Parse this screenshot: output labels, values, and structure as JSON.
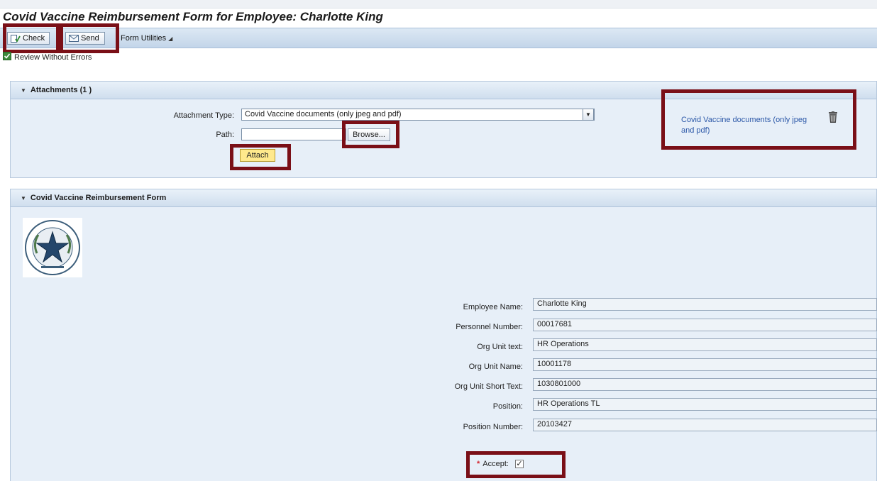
{
  "title": "Covid Vaccine Reimbursement Form for Employee: Charlotte King",
  "toolbar": {
    "check_label": "Check",
    "send_label": "Send",
    "utilities_label": "Form Utilities"
  },
  "status": "Review Without Errors",
  "attachments": {
    "header": "Attachments (1 )",
    "type_label": "Attachment Type:",
    "type_value": "Covid Vaccine documents (only jpeg and pdf)",
    "path_label": "Path:",
    "path_value": "",
    "browse_label": "Browse...",
    "attach_label": "Attach",
    "attached_file": "Covid Vaccine documents (only jpeg and pdf)"
  },
  "form": {
    "header": "Covid Vaccine Reimbursement Form",
    "fields": [
      {
        "label": "Employee Name:",
        "value": "Charlotte King"
      },
      {
        "label": "Personnel Number:",
        "value": "00017681"
      },
      {
        "label": "Org Unit text:",
        "value": "HR Operations"
      },
      {
        "label": "Org Unit Name:",
        "value": "10001178"
      },
      {
        "label": "Org Unit Short Text:",
        "value": "1030801000"
      },
      {
        "label": "Position:",
        "value": "HR Operations TL"
      },
      {
        "label": "Position Number:",
        "value": "20103427"
      }
    ],
    "accept_label": "Accept:",
    "accept_checked": true
  },
  "colors": {
    "highlight_box": "#7a0f17",
    "link": "#2c58a8",
    "panel_bg": "#e7eff8",
    "toolbar_bg": "#c3d5e9"
  }
}
